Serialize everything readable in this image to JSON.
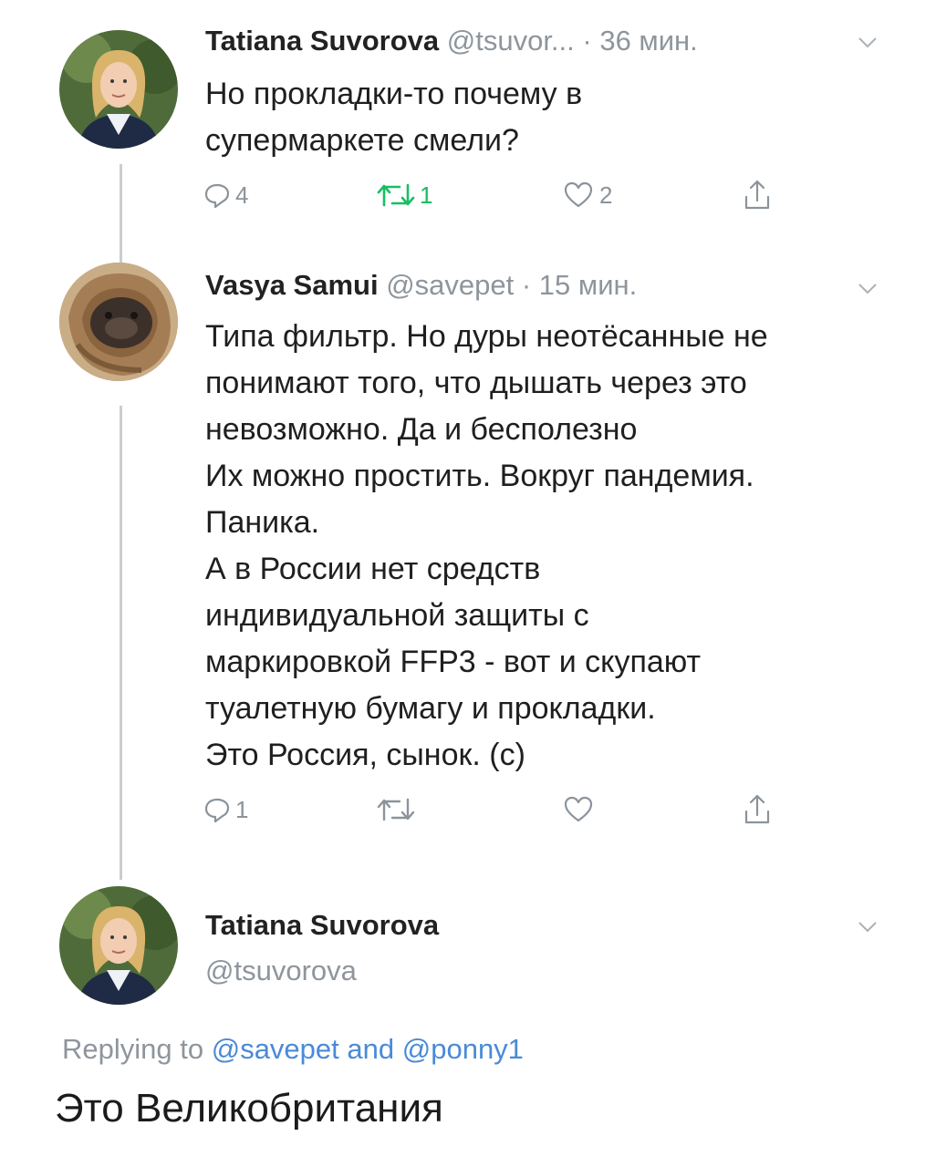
{
  "colors": {
    "line": "#c9cdd1",
    "meta": "#8e959c",
    "link": "#4a8ad8",
    "text": "#1f1f1f"
  },
  "tweet1": {
    "author": "Tatiana Suvorova",
    "handle": "@tsuvor...",
    "time": "· 36 мин.",
    "text": "Но прокладки-то почему в\nсупермаркете смели?",
    "replies": "4",
    "retweets": "1",
    "likes": "2"
  },
  "tweet2": {
    "author": "Vasya Samui",
    "handle": "@savepet",
    "time": "· 15 мин.",
    "text": "Типа фильтр. Но дуры неотёсанные не\nпонимают того, что дышать через это\nневозможно. Да и бесполезно\nИх можно простить. Вокруг пандемия.\nПаника.\nА в России нет средств\nиндивидуальной защиты с\nмаркировкой FFP3 - вот и скупают\nтуалетную бумагу и прокладки.\nЭто Россия, сынок. (с)",
    "replies": "1"
  },
  "tweet3": {
    "author": "Tatiana Suvorova",
    "handle": "@tsuvorova",
    "replying_prefix": "Replying to",
    "replying_user1": "@savepet",
    "replying_and": "and",
    "replying_user2": "@ponny1",
    "text": "Это Великобритания"
  },
  "icons": [
    "reply-icon",
    "retweet-icon",
    "like-icon",
    "share-icon",
    "chevron-down-icon"
  ]
}
